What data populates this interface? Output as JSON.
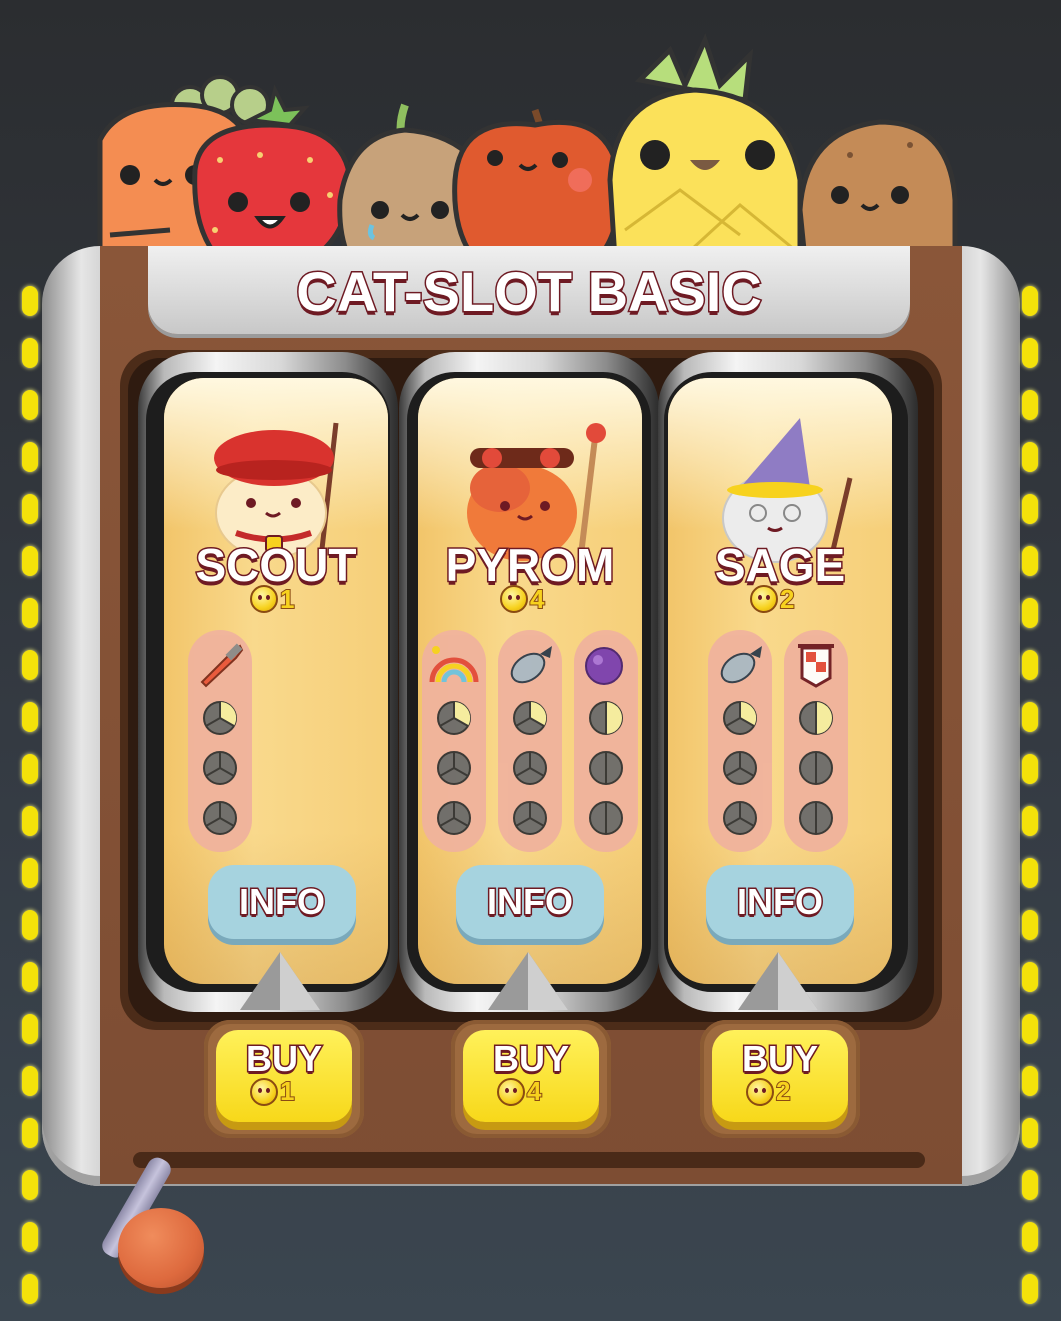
{
  "title": "CAT-SLOT BASIC",
  "colors": {
    "accent_text_outline": "#6e1a23",
    "coin": "#f7d21e",
    "info_button": "#a6d3df",
    "buy_button": "#f7d81a",
    "machine_body": "#8a5639"
  },
  "mascots": [
    "carrot",
    "strawberry",
    "onion",
    "apple",
    "pineapple",
    "potato"
  ],
  "slots": [
    {
      "name": "SCOUT",
      "cost": "1",
      "icon": "scout-cat",
      "abilities": [
        {
          "icon": "knife-icon",
          "pips": [
            "third",
            "empty-thirds",
            "empty-thirds"
          ]
        }
      ],
      "info_label": "INFO",
      "buy_label": "BUY",
      "buy_cost": "1"
    },
    {
      "name": "PYROM",
      "cost": "4",
      "icon": "pyrom-cat",
      "abilities": [
        {
          "icon": "rainbow-icon",
          "pips": [
            "third",
            "empty-thirds",
            "empty-thirds"
          ]
        },
        {
          "icon": "bomb-icon",
          "pips": [
            "third",
            "empty-thirds",
            "empty-thirds"
          ]
        },
        {
          "icon": "purple-orb-icon",
          "pips": [
            "half",
            "empty-halves",
            "empty-halves"
          ]
        }
      ],
      "info_label": "INFO",
      "buy_label": "BUY",
      "buy_cost": "4"
    },
    {
      "name": "SAGE",
      "cost": "2",
      "icon": "sage-cat",
      "abilities": [
        {
          "icon": "bomb-icon",
          "pips": [
            "third",
            "empty-thirds",
            "empty-thirds"
          ]
        },
        {
          "icon": "banner-icon",
          "pips": [
            "half",
            "empty-halves",
            "empty-halves"
          ]
        }
      ],
      "info_label": "INFO",
      "buy_label": "BUY",
      "buy_cost": "2"
    }
  ]
}
